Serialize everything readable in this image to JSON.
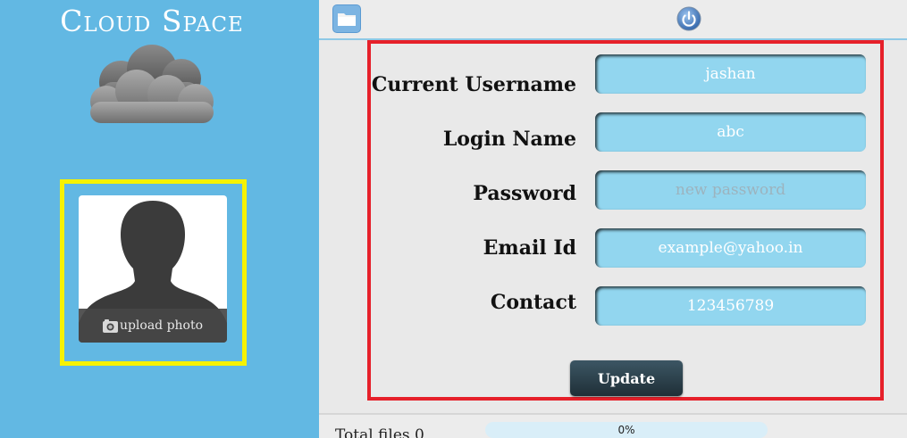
{
  "app": {
    "title": "Cloud Space"
  },
  "profile": {
    "upload_label": "upload photo"
  },
  "form": {
    "fields": [
      {
        "label": "Current Username",
        "value": "jashan",
        "placeholder": ""
      },
      {
        "label": "Login Name",
        "value": "abc",
        "placeholder": ""
      },
      {
        "label": "Password",
        "value": "",
        "placeholder": "new password"
      },
      {
        "label": "Email Id",
        "value": "example@yahoo.in",
        "placeholder": ""
      },
      {
        "label": "Contact",
        "value": "123456789",
        "placeholder": ""
      }
    ],
    "submit_label": "Update"
  },
  "footer": {
    "total_files": "Total files 0",
    "progress_text": "0%",
    "progress_fraction": 0.0
  },
  "icons": {
    "folder": "folder-icon",
    "power": "power-icon",
    "camera": "camera-icon",
    "logo": "cloud-logo"
  },
  "colors": {
    "sidebar": "#62b8e3",
    "field": "#92d6ef",
    "photo_highlight": "#f6f200",
    "form_highlight": "#e6202a",
    "progress": "#3ec3ee"
  }
}
